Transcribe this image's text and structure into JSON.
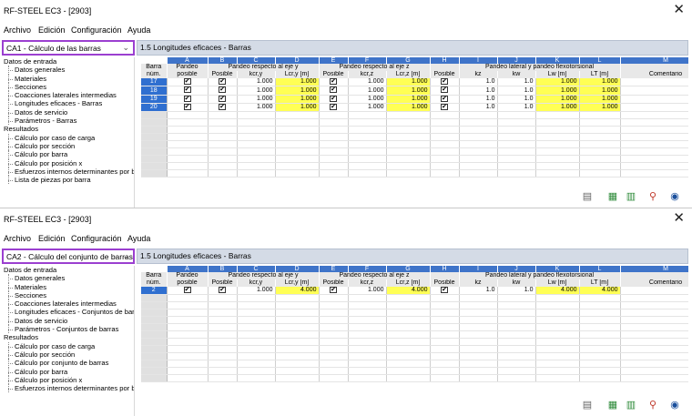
{
  "app_title_1": "RF-STEEL EC3 - [2903]",
  "app_title_2": "RF-STEEL EC3 - [2903]",
  "menu": [
    "Archivo",
    "Edición",
    "Configuración",
    "Ayuda"
  ],
  "case1": "CA1 - Cálculo de las barras",
  "case2": "CA2 - Cálculo del conjunto de barras",
  "panel1": "1.5 Longitudes eficaces - Barras",
  "panel2": "1.5 Longitudes eficaces - Barras",
  "tree1": [
    {
      "t": "Datos de entrada",
      "l": 0
    },
    {
      "t": "Datos generales",
      "l": 1
    },
    {
      "t": "Materiales",
      "l": 1
    },
    {
      "t": "Secciones",
      "l": 1
    },
    {
      "t": "Coacciones laterales intermedias",
      "l": 1
    },
    {
      "t": "Longitudes eficaces - Barras",
      "l": 1
    },
    {
      "t": "Datos de servicio",
      "l": 1
    },
    {
      "t": "Parámetros - Barras",
      "l": 1
    },
    {
      "t": "Resultados",
      "l": 0
    },
    {
      "t": "Cálculo por caso de carga",
      "l": 1
    },
    {
      "t": "Cálculo por sección",
      "l": 1
    },
    {
      "t": "Cálculo por barra",
      "l": 1
    },
    {
      "t": "Cálculo por posición x",
      "l": 1
    },
    {
      "t": "Esfuerzos internos determinantes por ba",
      "l": 1
    },
    {
      "t": "Lista de piezas por barra",
      "l": 1
    }
  ],
  "tree2": [
    {
      "t": "Datos de entrada",
      "l": 0
    },
    {
      "t": "Datos generales",
      "l": 1
    },
    {
      "t": "Materiales",
      "l": 1
    },
    {
      "t": "Secciones",
      "l": 1
    },
    {
      "t": "Coacciones laterales intermedias",
      "l": 1
    },
    {
      "t": "Longitudes eficaces - Conjuntos de barr",
      "l": 1
    },
    {
      "t": "Datos de servicio",
      "l": 1
    },
    {
      "t": "Parámetros - Conjuntos de barras",
      "l": 1
    },
    {
      "t": "Resultados",
      "l": 0
    },
    {
      "t": "Cálculo por caso de carga",
      "l": 1
    },
    {
      "t": "Cálculo por sección",
      "l": 1
    },
    {
      "t": "Cálculo por conjunto de barras",
      "l": 1
    },
    {
      "t": "Cálculo por barra",
      "l": 1
    },
    {
      "t": "Cálculo por posición x",
      "l": 1
    },
    {
      "t": "Esfuerzos internos determinantes por b",
      "l": 1
    }
  ],
  "letters": [
    "A",
    "B",
    "C",
    "D",
    "E",
    "F",
    "G",
    "H",
    "I",
    "J",
    "K",
    "L",
    "M"
  ],
  "group_headers": {
    "a": "Pandeo",
    "bd": "Pandeo respecto al eje y",
    "eg": "Pandeo respecto al eje z",
    "il": "Pandeo lateral y pandeo flexotorsional"
  },
  "sub_headers": {
    "row1": "Barra",
    "row2": "núm.",
    "a": "posible",
    "b": "Posible",
    "c": "kcr,y",
    "d": "Lcr,y [m]",
    "e": "Posible",
    "f": "kcr,z",
    "g": "Lcr,z [m]",
    "h": "Posible",
    "i": "kz",
    "j": "kw",
    "k": "Lw [m]",
    "l": "LT [m]",
    "m": "Comentario"
  },
  "table1": [
    {
      "n": "17",
      "c": "1.000",
      "d": "1.000",
      "f": "1.000",
      "g": "1.000",
      "i": "1.0",
      "j": "1.0",
      "k": "1.000",
      "l": "1.000"
    },
    {
      "n": "18",
      "c": "1.000",
      "d": "1.000",
      "f": "1.000",
      "g": "1.000",
      "i": "1.0",
      "j": "1.0",
      "k": "1.000",
      "l": "1.000"
    },
    {
      "n": "19",
      "c": "1.000",
      "d": "1.000",
      "f": "1.000",
      "g": "1.000",
      "i": "1.0",
      "j": "1.0",
      "k": "1.000",
      "l": "1.000"
    },
    {
      "n": "20",
      "c": "1.000",
      "d": "1.000",
      "f": "1.000",
      "g": "1.000",
      "i": "1.0",
      "j": "1.0",
      "k": "1.000",
      "l": "1.000"
    }
  ],
  "table2": [
    {
      "n": "2",
      "c": "1.000",
      "d": "4.000",
      "f": "1.000",
      "g": "4.000",
      "i": "1.0",
      "j": "1.0",
      "k": "4.000",
      "l": "4.000"
    }
  ],
  "check_mark": "✔",
  "toolbar_icons": [
    "print-icon",
    "export-excel-icon",
    "import-excel-icon",
    "filter-icon",
    "view-icon"
  ],
  "close_glyph": "✕",
  "chev": "⌄"
}
